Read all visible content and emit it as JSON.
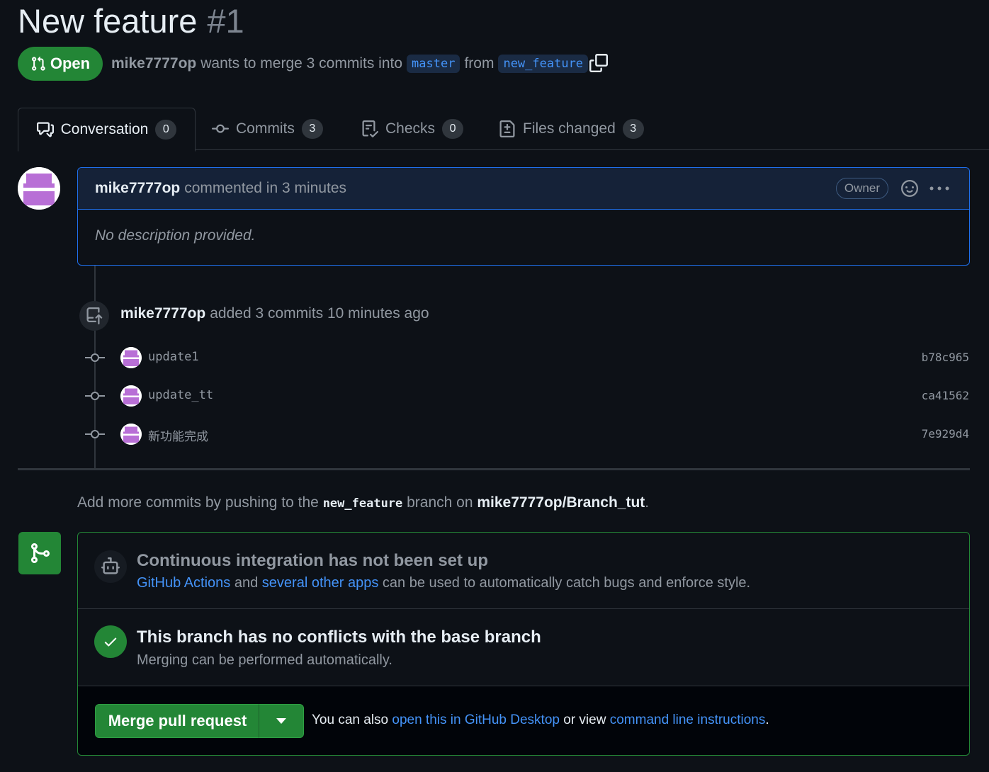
{
  "pr": {
    "title": "New feature",
    "number": "#1",
    "state": "Open",
    "author": "mike7777op",
    "merge_text": "wants to merge 3 commits into",
    "base_branch": "master",
    "from_text": "from",
    "head_branch": "new_feature"
  },
  "tabs": [
    {
      "label": "Conversation",
      "count": "0"
    },
    {
      "label": "Commits",
      "count": "3"
    },
    {
      "label": "Checks",
      "count": "0"
    },
    {
      "label": "Files changed",
      "count": "3"
    }
  ],
  "comment": {
    "author": "mike7777op",
    "meta": "commented in 3 minutes",
    "badge": "Owner",
    "body": "No description provided."
  },
  "push_event": {
    "author": "mike7777op",
    "text": "added 3 commits 10 minutes ago"
  },
  "commits": [
    {
      "message": "update1",
      "sha": "b78c965"
    },
    {
      "message": "update_tt",
      "sha": "ca41562"
    },
    {
      "message": "新功能完成",
      "sha": "7e929d4"
    }
  ],
  "hint": {
    "prefix": "Add more commits by pushing to the",
    "branch": "new_feature",
    "middle": "branch on",
    "repo": "mike7777op/Branch_tut",
    "suffix": "."
  },
  "ci": {
    "title": "Continuous integration has not been set up",
    "link1": "GitHub Actions",
    "and": "and",
    "link2": "several other apps",
    "rest": "can be used to automatically catch bugs and enforce style."
  },
  "conflicts": {
    "title": "This branch has no conflicts with the base branch",
    "subtitle": "Merging can be performed automatically."
  },
  "merge_actions": {
    "button": "Merge pull request",
    "prefix": "You can also",
    "link1": "open this in GitHub Desktop",
    "middle": "or view",
    "link2": "command line instructions",
    "suffix": "."
  },
  "colors": {
    "background": "#0d1117",
    "accent_green": "#238636",
    "link_blue": "#4493f8",
    "muted": "#9198a1"
  }
}
